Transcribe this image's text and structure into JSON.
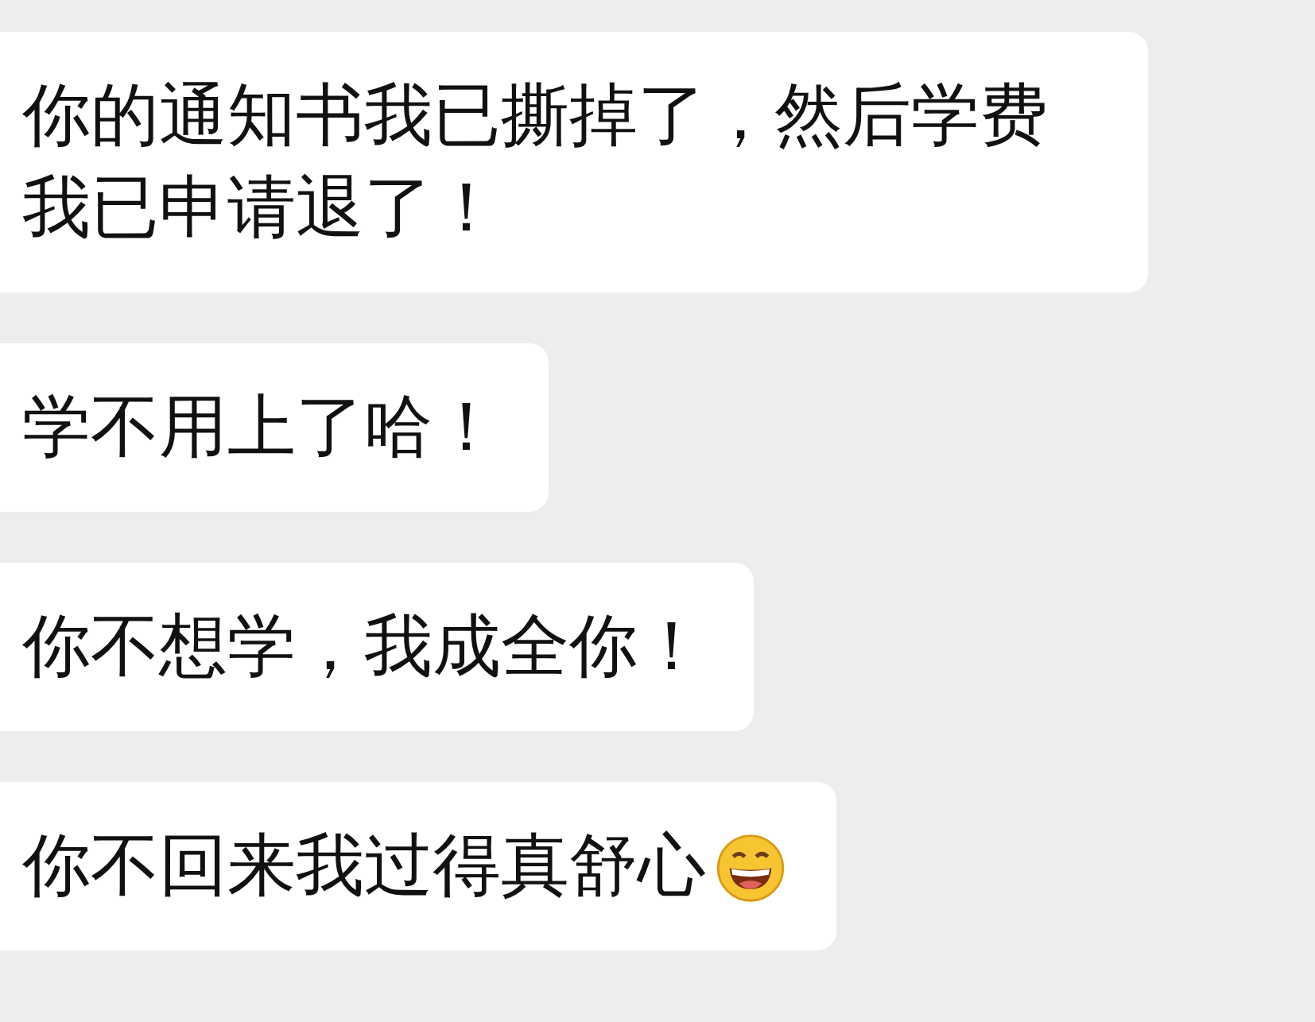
{
  "messages": [
    {
      "text": "你的通知书我已撕掉了，然后学费我已申请退了！",
      "emoji": false
    },
    {
      "text": "学不用上了哈！",
      "emoji": false
    },
    {
      "text": "你不想学，我成全你！",
      "emoji": false
    },
    {
      "text": "你不回来我过得真舒心",
      "emoji": true
    }
  ]
}
